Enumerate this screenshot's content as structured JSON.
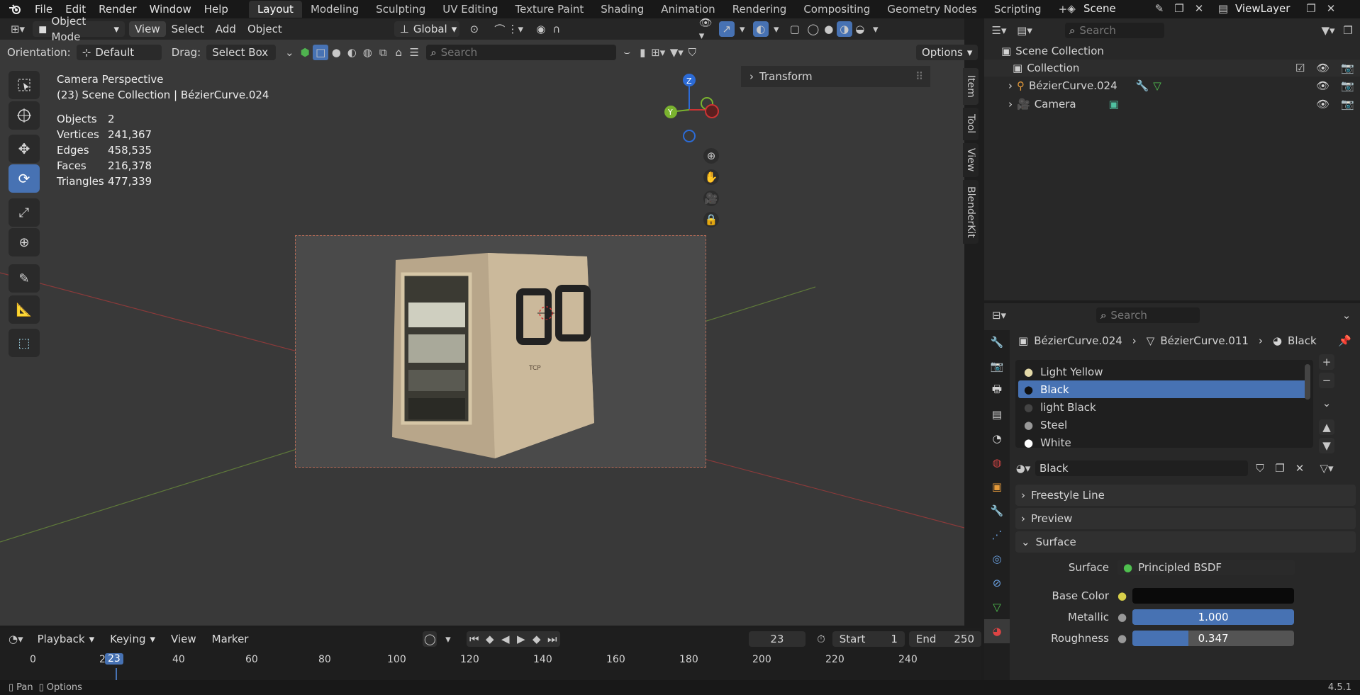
{
  "top_menu": {
    "file": "File",
    "edit": "Edit",
    "render": "Render",
    "window": "Window",
    "help": "Help"
  },
  "workspaces": [
    "Layout",
    "Modeling",
    "Sculpting",
    "UV Editing",
    "Texture Paint",
    "Shading",
    "Animation",
    "Rendering",
    "Compositing",
    "Geometry Nodes",
    "Scripting"
  ],
  "scene": "Scene",
  "view_layer": "ViewLayer",
  "vp_header": {
    "mode": "Object Mode",
    "view": "View",
    "select": "Select",
    "add": "Add",
    "object": "Object",
    "transform": "Global"
  },
  "vp_header2": {
    "orientation_label": "Orientation:",
    "orientation": "Default",
    "drag_label": "Drag:",
    "drag": "Select Box",
    "search_placeholder": "Search",
    "options": "Options"
  },
  "overlay_info": {
    "title": "Camera Perspective",
    "subtitle": "(23) Scene Collection | BézierCurve.024",
    "stats": [
      {
        "label": "Objects",
        "value": "2"
      },
      {
        "label": "Vertices",
        "value": "241,367"
      },
      {
        "label": "Edges",
        "value": "458,535"
      },
      {
        "label": "Faces",
        "value": "216,378"
      },
      {
        "label": "Triangles",
        "value": "477,339"
      }
    ]
  },
  "npanel": {
    "transform": "Transform",
    "tabs": [
      "Item",
      "Tool",
      "View",
      "BlenderKit"
    ]
  },
  "gizmo": {
    "z": "Z",
    "y": "Y"
  },
  "model_label": "TCP",
  "outliner": {
    "search_placeholder": "Search",
    "scene_collection": "Scene Collection",
    "collection": "Collection",
    "items": [
      "BézierCurve.024",
      "Camera"
    ]
  },
  "props": {
    "search_placeholder": "Search",
    "breadcrumb": [
      "BézierCurve.024",
      "BézierCurve.011",
      "Black"
    ],
    "slots": [
      "Light Yellow",
      "Black",
      "light Black",
      "Steel",
      "White"
    ],
    "material_name": "Black",
    "panels": {
      "freestyle": "Freestyle Line",
      "preview": "Preview",
      "surface": "Surface"
    },
    "surface_label": "Surface",
    "surface_value": "Principled BSDF",
    "base_color": "Base Color",
    "metallic_label": "Metallic",
    "metallic_value": "1.000",
    "metallic": 1.0,
    "roughness_label": "Roughness",
    "roughness_value": "0.347",
    "roughness": 0.347
  },
  "timeline": {
    "playback": "Playback",
    "keying": "Keying",
    "view": "View",
    "marker": "Marker",
    "current": "23",
    "start_label": "Start",
    "start": "1",
    "end_label": "End",
    "end": "250",
    "ticks": [
      "0",
      "2",
      "20",
      "40",
      "60",
      "80",
      "100",
      "120",
      "140",
      "160",
      "180",
      "200",
      "220",
      "240"
    ],
    "playhead": "23"
  },
  "status": {
    "pan": "Pan",
    "options": "Options",
    "version": "4.5.1"
  }
}
